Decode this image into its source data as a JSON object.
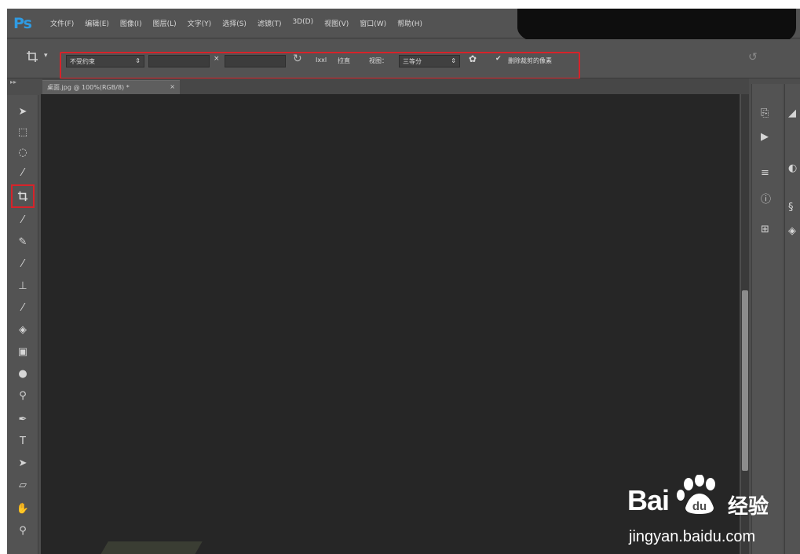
{
  "app": {
    "logo": "Ps",
    "menu": [
      "文件(F)",
      "编辑(E)",
      "图像(I)",
      "图层(L)",
      "文字(Y)",
      "选择(S)",
      "滤镜(T)",
      "3D(D)",
      "视图(V)",
      "窗口(W)",
      "帮助(H)"
    ]
  },
  "options": {
    "ratio_value": "不受约束",
    "x_sep": "×",
    "straighten_icon_text": "Ixxl",
    "straighten_label": "拉直",
    "view_label": "视图：",
    "view_value": "三等分",
    "delete_cropped_label": "删除裁剪的像素",
    "delete_cropped_checked": true
  },
  "document": {
    "tab_title": "桌面.jpg @ 100%(RGB/8) *",
    "tab_close": "×"
  },
  "toolbar": {
    "tools": [
      "move-tool",
      "marquee-tool",
      "lasso-tool",
      "quick-select-tool",
      "crop-tool",
      "eyedropper-tool",
      "healing-brush-tool",
      "brush-tool",
      "clone-stamp-tool",
      "history-brush-tool",
      "eraser-tool",
      "gradient-tool",
      "blur-tool",
      "dodge-tool",
      "pen-tool",
      "type-tool",
      "path-select-tool",
      "shape-tool",
      "hand-tool",
      "zoom-tool"
    ],
    "active_tool": "crop-tool",
    "highlight_color": "#d7232a"
  },
  "watermark": {
    "brand": "Bai",
    "paw_text": "du",
    "suffix": "经验",
    "url": "jingyan.baidu.com"
  },
  "colors": {
    "accent_logo": "#2f9be3",
    "highlight": "#d7232a",
    "canvas": "#262626",
    "chrome": "#535353"
  }
}
